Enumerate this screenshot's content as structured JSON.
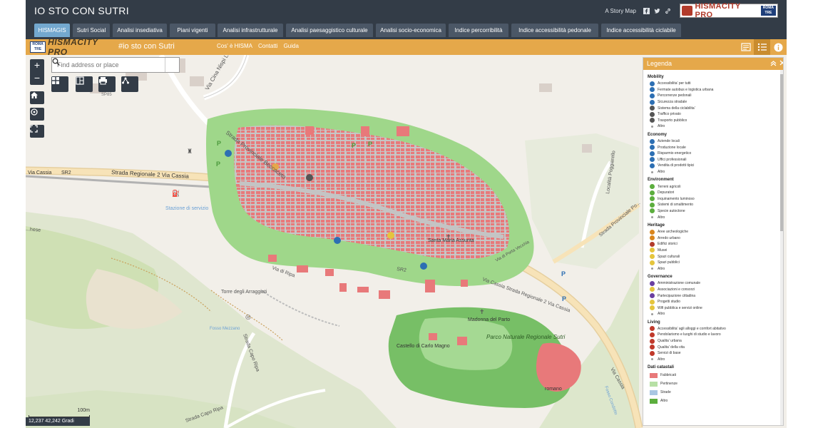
{
  "header": {
    "title": "IO STO CON SUTRI",
    "byline": "A Story Map",
    "logo_text": "HISMACITY PRO",
    "logo_uni": "ROMA TRE"
  },
  "tabs": [
    "HISMAGIS",
    "Sutri Social",
    "Analisi insediativa",
    "Piani vigenti",
    "Analisi infrastrutturale",
    "Analisi paesaggistico culturale",
    "Analisi socio-economica",
    "Indice percorribilità",
    "Indice accessibilità pedonale",
    "Indice accessibilità ciclabile"
  ],
  "appbar": {
    "logo_text": "HISMACITY PRO",
    "logo_uni": "ROMA TRE",
    "title": "#io sto con Sutri",
    "links": [
      "Cos' è HISMA",
      "Contatti",
      "Guida"
    ]
  },
  "search": {
    "placeholder": "Find address or place"
  },
  "map": {
    "labels": {
      "via_cina": "Via Cina Nispi Landi",
      "strada_prov_beccaceto": "Strada Provinciale Beccaceto",
      "strada_reg": "Strada Regionale 2 Via Cassia",
      "sr2_left": "SR2",
      "via_cassia_left": "Via Cassia",
      "stazione": "Stazione di servizio",
      "via_ripa": "Via di Ripa",
      "sr2_mid": "SR2",
      "via_cassia_mid": "Via Cassia Strada Regionale 2 Via Cassia",
      "torre": "Torre degli Arraggiati",
      "fosso_mezzano": "Fosso Mezzano",
      "strada_capo_ripa": "Strada Capo Ripa",
      "strada_capo_ripa_2": "Strada Capo Ripa",
      "parco": "Parco Naturale Regionale Sutri",
      "madonna": "Madonna del Parto",
      "castello": "Castello di Carlo Magno",
      "romano": "romano",
      "localita": "Località Poggiarello",
      "strada_prov_right": "Strada Provinciale Po...",
      "via_cassia_right": "Via Cassia",
      "fosso_condotto": "Fosso Condotto",
      "santa": "Santa Maria Assunta",
      "via_porta": "Via di Porta Vecchia",
      "ahese": "...hese",
      "sp": "SP85"
    }
  },
  "scale": {
    "label": "100m"
  },
  "coords": {
    "text": "12,237 42,242 Gradi"
  },
  "legend": {
    "title": "Legenda",
    "groups": [
      {
        "name": "Mobility",
        "color": "#2d6fb3",
        "items": [
          "Accessibilita' per tutti",
          "Fermate autobus e logistica urbana",
          "Percorrenze pedonali",
          "Sicurezza stradale",
          "Sistema della ciclabilita'",
          "Traffico privato",
          "Trasporto pubblico"
        ],
        "other": "Altro"
      },
      {
        "name": "Economy",
        "color": "#2d6fb3",
        "items": [
          "Aziende locali",
          "Produzione locale",
          "Risparmio energetico",
          "Uffici professionali",
          "Vendita di prodotti tipici"
        ],
        "other": "Altro"
      },
      {
        "name": "Environment",
        "color": "#5cae3e",
        "items": [
          "Terreni agricoli",
          "Depuratori",
          "Inquinamento luminoso",
          "Sistemi di smaltimento",
          "Specie autoctone"
        ],
        "other": "Altro"
      },
      {
        "name": "Heritage",
        "color": "#d9861e",
        "items": [
          "Aree archeologiche",
          "Arredo urbano",
          "Edifici storici",
          "Musei",
          "Spazi culturali",
          "Spazi pubblici"
        ],
        "other": "Altro"
      },
      {
        "name": "Governance",
        "color": "#6a3fa0",
        "items": [
          "Amministrazione comunale",
          "Associazioni e consorzi",
          "Partecipazione cittadina",
          "Progetti studio",
          "Wifi pubblica e servizi online"
        ],
        "other": "Altro"
      },
      {
        "name": "Living",
        "color": "#c0392b",
        "items": [
          "Accessibilita' agli alloggi e comfort abitativo",
          "Pendolarismo e luoghi di studio e lavoro",
          "Qualita' urbana",
          "Qualita' della vita",
          "Servizi di base"
        ],
        "other": "Altro"
      }
    ],
    "cadastral": {
      "name": "Dati catastali",
      "items": [
        {
          "label": "Fabbricati",
          "color": "#e8797a"
        },
        {
          "label": "Pertinenze",
          "color": "#b7e0a5"
        },
        {
          "label": "Strade",
          "color": "#a9c7e2"
        },
        {
          "label": "Altro",
          "color": "#5cae3e"
        }
      ]
    }
  },
  "colors": {
    "header_bg": "#333c47",
    "tab_bg": "#4b5766",
    "tab_active": "#73a8cf",
    "appbar_bg": "#e5a84a",
    "buildings": "#e8797a",
    "green_area": "#9fd78a",
    "park": "#77bf66"
  }
}
